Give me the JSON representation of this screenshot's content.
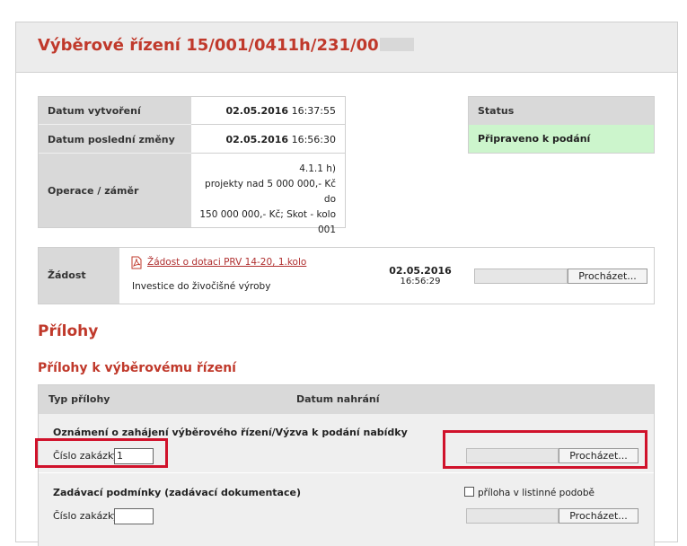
{
  "header": {
    "title": "Výběrové řízení 15/001/0411h/231/00"
  },
  "info": {
    "rows": [
      {
        "label": "Datum vytvoření",
        "date": "02.05.2016",
        "time": "16:37:55"
      },
      {
        "label": "Datum poslední změny",
        "date": "02.05.2016",
        "time": "16:56:30"
      }
    ],
    "operation_label": "Operace / záměr",
    "operation_lines": [
      "4.1.1 h)",
      "projekty nad 5 000 000,- Kč do",
      "150 000 000,- Kč; Skot - kolo",
      "001"
    ]
  },
  "status": {
    "label": "Status",
    "value": "Připraveno k podání",
    "color": "#ccf5cc"
  },
  "zadost": {
    "label": "Žádost",
    "link": "Žádost o dotaci PRV 14-20, 1.kolo",
    "description": "Investice do živočišné výroby",
    "date": "02.05.2016",
    "time": "16:56:29",
    "browse_label": "Procházet..."
  },
  "prilohy": {
    "title": "Přílohy",
    "subtitle": "Přílohy k výběrovému řízení",
    "col_type": "Typ přílohy",
    "col_date": "Datum nahrání",
    "rows": [
      {
        "name": "Oznámení o zahájení výběrového řízení/Výzva k podání nabídky",
        "order_label": "Číslo zakázky:",
        "order_value": "1",
        "browse_label": "Procházet..."
      },
      {
        "name": "Zadávací podmínky (zadávací dokumentace)",
        "order_label": "Číslo zakázky:",
        "order_value": "",
        "paper_label": "příloha v listinné podobě",
        "browse_label": "Procházet..."
      }
    ]
  },
  "colors": {
    "accent": "#c0392b",
    "highlight": "#d0122b"
  },
  "icons": {
    "pdf": "pdf-icon"
  }
}
